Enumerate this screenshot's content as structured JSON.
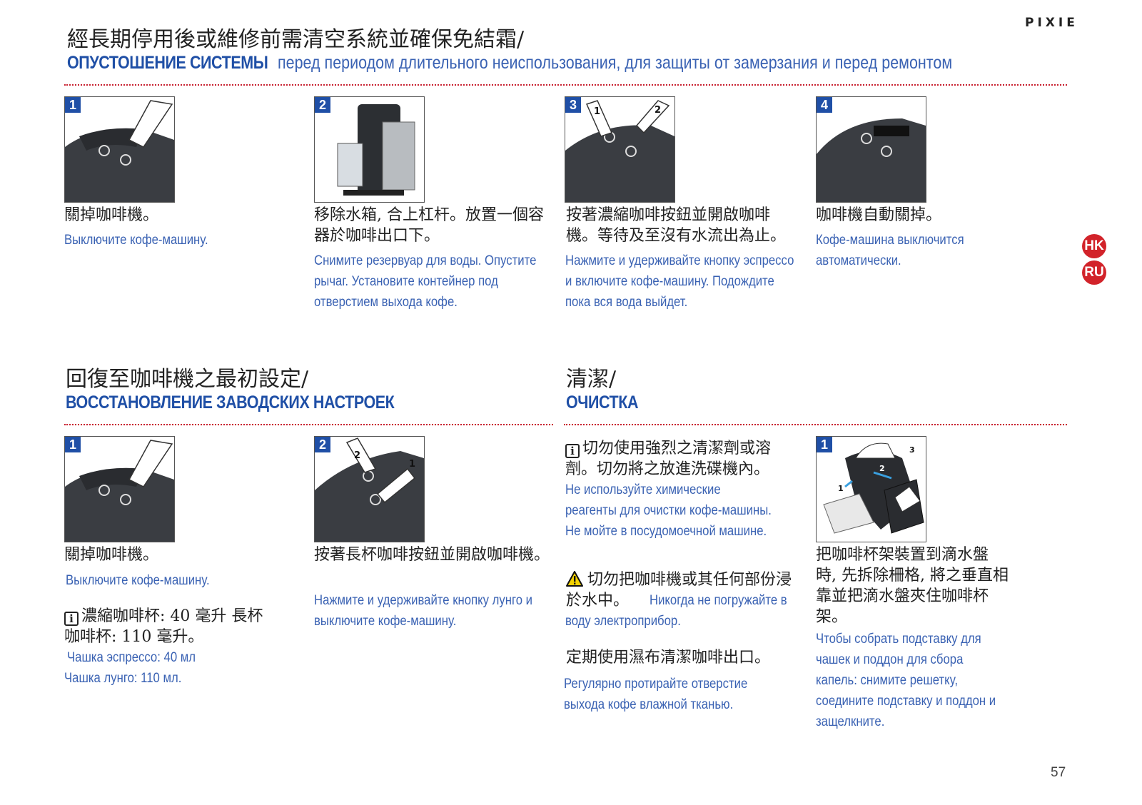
{
  "brand": "PIXIE",
  "page_number": "57",
  "lang_badges": [
    "HK",
    "RU"
  ],
  "section1": {
    "title_zh": "經長期停用後或維修前需清空系統並確保免結霜/",
    "title_ru": "ОПУСТОШЕНИЕ СИСТЕМЫ",
    "subtitle_ru": "перед периодом длительного неиспользования, для защиты от замерзания и перед ремонтом",
    "steps": [
      {
        "num": "1",
        "zh": "關掉咖啡機。",
        "ru": "Выключите кофе-машину."
      },
      {
        "num": "2",
        "zh": "移除水箱, 合上杠杆。放置一個容器於咖啡出口下。",
        "ru": "Снимите резервуар для воды. Опустите рычаг. Установите контейнер под отверстием выхода кофе."
      },
      {
        "num": "3",
        "zh": "按著濃縮咖啡按鈕並開啟咖啡機。等待及至沒有水流出為止。",
        "ru": "Нажмите и удерживайте кнопку эспрессо и включите кофе-машину. Подождите пока вся вода выйдет."
      },
      {
        "num": "4",
        "zh": "咖啡機自動關掉。",
        "ru": "Кофе-машина выключится автоматически."
      }
    ]
  },
  "section2": {
    "title_zh": "回復至咖啡機之最初設定/",
    "title_ru": "ВОССТАНОВЛЕНИЕ ЗАВОДСКИХ НАСТРОЕК",
    "steps": [
      {
        "num": "1",
        "zh": "關掉咖啡機。",
        "ru": "Выключите кофе-машину."
      },
      {
        "num": "2",
        "zh": "按著長杯咖啡按鈕並開啟咖啡機。",
        "ru": "Нажмите и удерживайте кнопку лунго и выключите кофе-машину."
      }
    ],
    "info_zh": "濃縮咖啡杯: 40 毫升 長杯咖啡杯: 110 毫升。",
    "info_ru_1": "Чашка эспрессо: 40 мл",
    "info_ru_2": "Чашка лунго: 110 мл."
  },
  "section3": {
    "title_zh": "清潔/",
    "title_ru": "ОЧИСТКА",
    "info_zh": "切勿使用強烈之清潔劑或溶劑。切勿將之放進洗碟機內。",
    "info_ru": "Не используйте химические реагенты для очистки кофе-машины. Не мойте в посудомоечной машине.",
    "warn_zh": "切勿把咖啡機或其任何部份浸於水中。",
    "warn_ru": "Никогда не погружайте в воду электроприбор.",
    "wipe_zh": "定期使用濕布清潔咖啡出口。",
    "wipe_ru": "Регулярно протирайте отверстие выхода кофе влажной тканью.",
    "step": {
      "num": "1",
      "zh": "把咖啡杯架裝置到滴水盤時, 先拆除柵格, 將之垂直相靠並把滴水盤夾住咖啡杯架。",
      "ru": "Чтобы собрать подставку для чашек и поддон для сбора капель: снимите решетку, соедините  подставку и поддон и защелкните."
    }
  },
  "colors": {
    "accent_blue": "#1f4fa6",
    "text_blue": "#3a62b3",
    "accent_red": "#d2232a"
  },
  "icons": [
    "info-icon",
    "warning-icon"
  ]
}
